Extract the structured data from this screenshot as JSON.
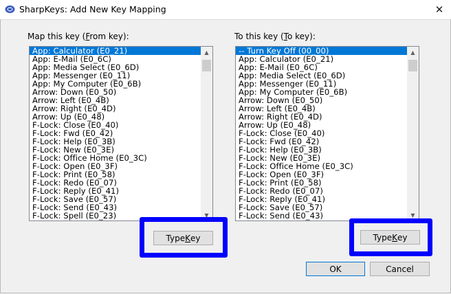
{
  "window": {
    "title": "SharpKeys: Add New Key Mapping",
    "close_glyph": "✕"
  },
  "from_panel": {
    "label_prefix": "Map this key (",
    "label_accel": "F",
    "label_suffix": "rom key):",
    "items": [
      "App: Calculator (E0_21)",
      "App: E-Mail (E0_6C)",
      "App: Media Select (E0_6D)",
      "App: Messenger (E0_11)",
      "App: My Computer (E0_6B)",
      "Arrow: Down (E0_50)",
      "Arrow: Left (E0_4B)",
      "Arrow: Right (E0_4D)",
      "Arrow: Up (E0_48)",
      "F-Lock: Close (E0_40)",
      "F-Lock: Fwd (E0_42)",
      "F-Lock: Help (E0_3B)",
      "F-Lock: New (E0_3E)",
      "F-Lock: Office Home (E0_3C)",
      "F-Lock: Open (E0_3F)",
      "F-Lock: Print (E0_58)",
      "F-Lock: Redo (E0_07)",
      "F-Lock: Reply (E0_41)",
      "F-Lock: Save (E0_57)",
      "F-Lock: Send (E0_43)",
      "F-Lock: Spell (E0_23)"
    ],
    "selected_index": 0,
    "type_key_prefix": "Type ",
    "type_key_accel": "K",
    "type_key_suffix": "ey"
  },
  "to_panel": {
    "label_prefix": "To this key (",
    "label_accel": "T",
    "label_suffix": "o key):",
    "items": [
      "-- Turn Key Off (00_00)",
      "App: Calculator (E0_21)",
      "App: E-Mail (E0_6C)",
      "App: Media Select (E0_6D)",
      "App: Messenger (E0_11)",
      "App: My Computer (E0_6B)",
      "Arrow: Down (E0_50)",
      "Arrow: Left (E0_4B)",
      "Arrow: Right (E0_4D)",
      "Arrow: Up (E0_48)",
      "F-Lock: Close (E0_40)",
      "F-Lock: Fwd (E0_42)",
      "F-Lock: Help (E0_3B)",
      "F-Lock: New (E0_3E)",
      "F-Lock: Office Home (E0_3C)",
      "F-Lock: Open (E0_3F)",
      "F-Lock: Print (E0_58)",
      "F-Lock: Redo (E0_07)",
      "F-Lock: Reply (E0_41)",
      "F-Lock: Save (E0_57)",
      "F-Lock: Send (E0_43)"
    ],
    "selected_index": 0,
    "type_key_prefix": "Type ",
    "type_key_accel": "K",
    "type_key_suffix": "ey"
  },
  "buttons": {
    "ok": "OK",
    "cancel": "Cancel"
  },
  "colors": {
    "selection": "#0078d7",
    "highlight_annotation": "#0000ff"
  },
  "scroll_glyphs": {
    "up": "▲",
    "down": "▼"
  }
}
